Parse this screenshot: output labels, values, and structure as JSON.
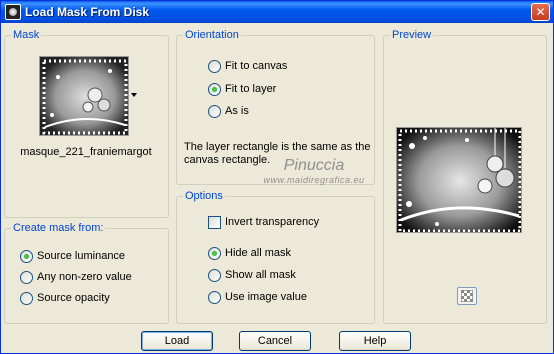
{
  "window": {
    "title": "Load Mask From Disk",
    "close_glyph": "✕",
    "icon": "mask-icon"
  },
  "mask": {
    "title": "Mask",
    "name": "masque_221_franiemargot",
    "thumbnail_icon": "mask-thumbnail-icon"
  },
  "orientation": {
    "title": "Orientation",
    "options": [
      "Fit to canvas",
      "Fit to layer",
      "As is"
    ],
    "selected": "Fit to layer",
    "info": "The layer rectangle is the same as the canvas rectangle."
  },
  "create_mask": {
    "title": "Create mask from:",
    "options": [
      "Source luminance",
      "Any non-zero value",
      "Source opacity"
    ],
    "selected": "Source luminance"
  },
  "options": {
    "title": "Options",
    "invert_label": "Invert transparency",
    "invert_checked": false,
    "radios": [
      "Hide all mask",
      "Show all mask",
      "Use image value"
    ],
    "selected": "Hide all mask"
  },
  "preview": {
    "title": "Preview",
    "zoom_icon": "checkerboard-icon"
  },
  "watermark": {
    "title": "Pinuccia",
    "url": "www.maidiregrafica.eu"
  },
  "buttons": {
    "load": "Load",
    "cancel": "Cancel",
    "help": "Help"
  }
}
